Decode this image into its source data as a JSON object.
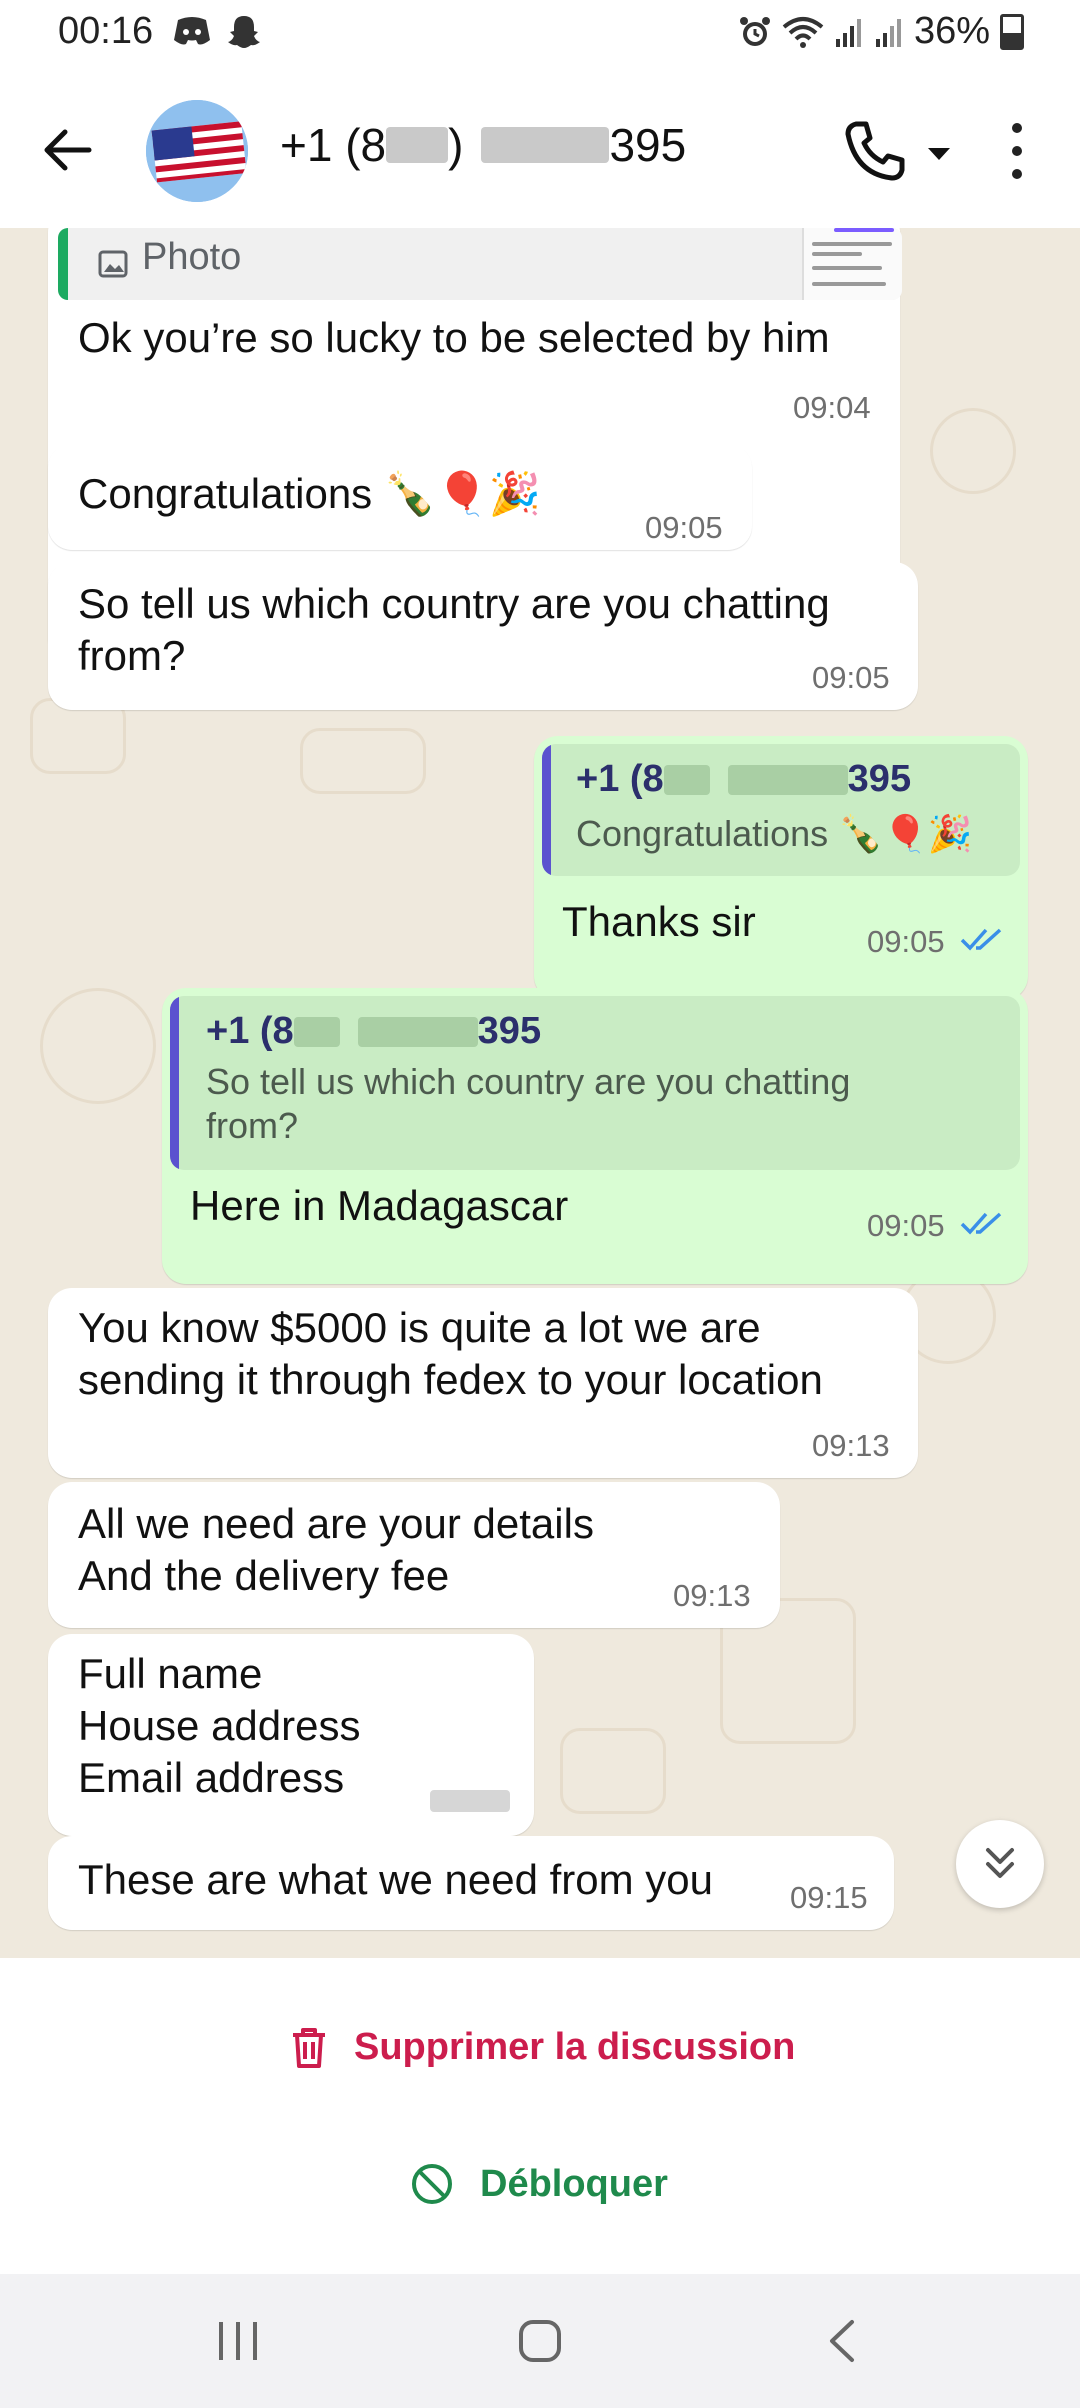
{
  "status_bar": {
    "time": "00:16",
    "battery": "36%",
    "left_icons": [
      "discord-icon",
      "snapchat-icon"
    ],
    "right_icons": [
      "alarm-icon",
      "wifi-icon",
      "signal-icon",
      "signal-icon",
      "battery-icon"
    ]
  },
  "header": {
    "contact_prefix": "+1 (8",
    "contact_mid": ")",
    "contact_suffix": "395",
    "avatar": "us-flag"
  },
  "messages": [
    {
      "id": "m1",
      "dir": "in",
      "quote": {
        "label": "Photo"
      },
      "text": "Ok you’re so lucky to be selected by him",
      "time": "09:04"
    },
    {
      "id": "m2",
      "dir": "in",
      "text": "Congratulations 🍾🎈🎉",
      "time": "09:05"
    },
    {
      "id": "m3",
      "dir": "in",
      "text": "So tell us which country are you chatting\nfrom?",
      "time": "09:05"
    },
    {
      "id": "m4",
      "dir": "out",
      "quote": {
        "name_prefix": "+1 (8",
        "name_suffix": "395",
        "text": "Congratulations 🍾🎈🎉"
      },
      "text": "Thanks sir",
      "time": "09:05",
      "ticks": "read"
    },
    {
      "id": "m5",
      "dir": "out",
      "quote": {
        "name_prefix": "+1 (8",
        "name_suffix": "395",
        "text": "So tell us which country are you chatting\nfrom?"
      },
      "text": "Here in Madagascar",
      "time": "09:05",
      "ticks": "read"
    },
    {
      "id": "m6",
      "dir": "in",
      "text": "You know $5000 is quite a lot we are\nsending it through fedex to your location",
      "time": "09:13"
    },
    {
      "id": "m7",
      "dir": "in",
      "text": "All we need are your details\nAnd the delivery fee",
      "time": "09:13"
    },
    {
      "id": "m8",
      "dir": "in",
      "text": "Full name\nHouse address\nEmail address",
      "time": ""
    },
    {
      "id": "m9",
      "dir": "in",
      "text": "These are what we need from you",
      "time": "09:15"
    }
  ],
  "actions": {
    "delete": "Supprimer la discussion",
    "unblock": "Débloquer"
  },
  "colors": {
    "chat_bg": "#efe9dd",
    "outgoing": "#d9fdd3",
    "quote_accent": "#5b52cf",
    "delete": "#cc1d4d",
    "unblock": "#1f8a4c",
    "read_ticks": "#3a8fe8"
  }
}
